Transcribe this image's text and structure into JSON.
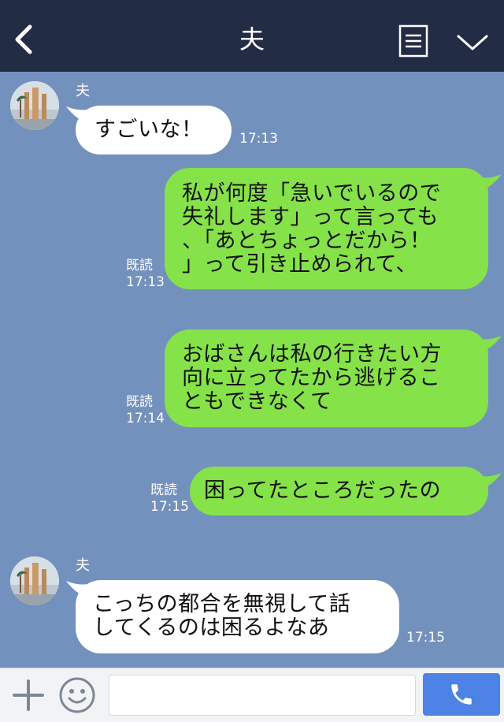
{
  "header": {
    "title": "夫"
  },
  "messages": [
    {
      "sender": "夫",
      "text": "すごいな！",
      "time": "17:13"
    },
    {
      "lines": [
        "私が何度「急いでいるので",
        "失礼します」って言っても",
        "、「あとちょっとだから！",
        "」って引き止められて、"
      ],
      "read": "既読",
      "time": "17:13"
    },
    {
      "lines": [
        "おばさんは私の行きたい方",
        "向に立ってたから逃げるこ",
        "ともできなくて"
      ],
      "read": "既読",
      "time": "17:14"
    },
    {
      "text": "困ってたところだったの",
      "read": "既読",
      "time": "17:15"
    },
    {
      "sender": "夫",
      "lines": [
        "こっちの都合を無視して話",
        "してくるのは困るよなあ"
      ],
      "time": "17:15"
    }
  ],
  "input": {
    "placeholder": ""
  },
  "icons": {
    "back": "back-arrow-icon",
    "menu": "menu-list-icon",
    "collapse": "chevron-down-icon",
    "add": "plus-icon",
    "emoji": "smiley-icon",
    "call": "phone-icon"
  },
  "colors": {
    "header_bg": "#222c45",
    "chat_bg": "#7391bd",
    "outgoing_bubble": "#85e249",
    "incoming_bubble": "#ffffff",
    "call_button": "#4c83e4"
  }
}
